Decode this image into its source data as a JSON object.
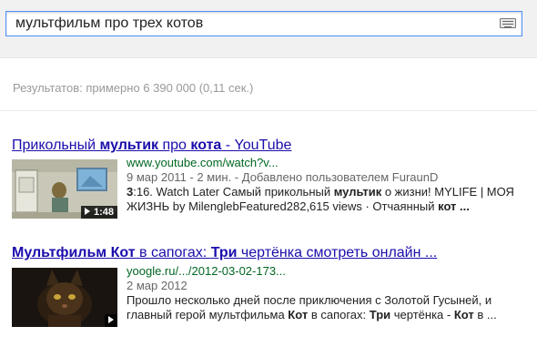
{
  "search": {
    "query": "мультфильм про трех котов",
    "keyboard_icon": "keyboard-icon"
  },
  "stats": "Результатов: примерно 6 390 000 (0,11 сек.)",
  "results": [
    {
      "title_parts": [
        "Прикольный ",
        "мультик",
        " про ",
        "кота",
        " - YouTube"
      ],
      "url": "www.youtube.com/watch?v...",
      "date": "9 мар 2011 - 2 мин. - Добавлено пользователем FuraunD",
      "duration": "1:48",
      "snippet_parts": [
        "3",
        ":16. Watch Later Самый прикольный ",
        "мультик",
        " о жизни! MYLIFE | МОЯ ЖИЗНЬ by MilenglebFeatured282,615 views · Отчаянный ",
        "кот ..."
      ]
    },
    {
      "title_parts": [
        "Мультфильм",
        " ",
        "Кот",
        " в сапогах: ",
        "Три",
        " чертёнка смотреть онлайн ..."
      ],
      "url": "yoogle.ru/.../2012-03-02-173...",
      "date": "2 мар 2012",
      "duration": "",
      "snippet_parts": [
        "Прошло несколько дней после приключения с Золотой Гусыней, и главный герой мультфильма ",
        "Кот",
        " в сапогах: ",
        "Три",
        " чертёнка - ",
        "Кот",
        " в ..."
      ]
    }
  ]
}
